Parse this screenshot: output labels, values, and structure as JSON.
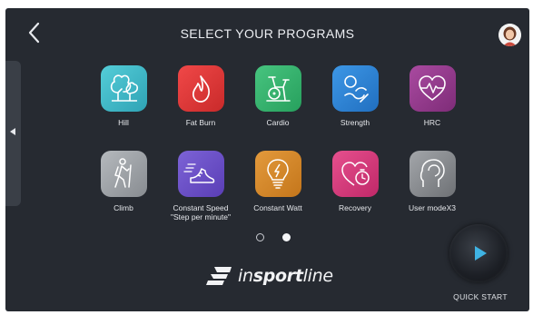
{
  "header": {
    "title": "SELECT YOUR PROGRAMS"
  },
  "programs": [
    {
      "label": "Hill",
      "icon": "tree-icon",
      "color": "#3fb7c6"
    },
    {
      "label": "Fat Burn",
      "icon": "flame-icon",
      "color": "#e33b3b"
    },
    {
      "label": "Cardio",
      "icon": "exercise-bike-icon",
      "color": "#35b26f"
    },
    {
      "label": "Strength",
      "icon": "strength-icon",
      "color": "#2f86d8"
    },
    {
      "label": "HRC",
      "icon": "heart-rate-icon",
      "color": "#9a3a8e"
    },
    {
      "label": "Climb",
      "icon": "hiker-icon",
      "color": "#9ea3a8"
    },
    {
      "label": "Constant Speed",
      "label2": "\"Step per minute\"",
      "icon": "running-shoe-icon",
      "color": "#6f52c9"
    },
    {
      "label": "Constant Watt",
      "icon": "lightbulb-icon",
      "color": "#d98a2a"
    },
    {
      "label": "Recovery",
      "icon": "heart-stopwatch-icon",
      "color": "#d83a7a"
    },
    {
      "label": "User modeX3",
      "icon": "user-profile-icon",
      "color": "#8a8d91"
    }
  ],
  "pagination": {
    "total": 2,
    "active": 2
  },
  "brand": {
    "name_light": "in",
    "name_bold": "sport",
    "name_tail": "line"
  },
  "quick_start": {
    "label": "QUICK START",
    "accent": "#3fb3e3"
  }
}
